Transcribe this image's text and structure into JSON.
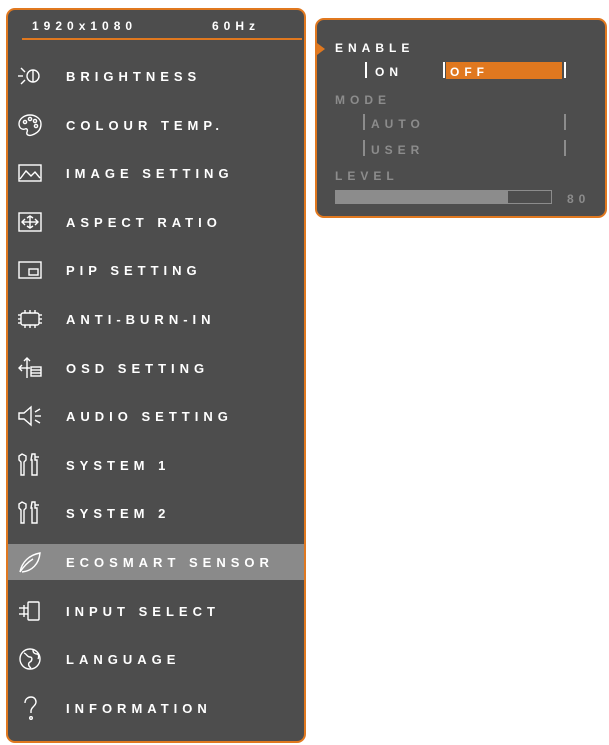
{
  "status_bar": {
    "resolution": "1920x1080",
    "refresh_rate": "60Hz"
  },
  "main_menu": {
    "selected_index": 10,
    "items": [
      {
        "label": "BRIGHTNESS",
        "icon": "brightness-icon"
      },
      {
        "label": "COLOUR TEMP.",
        "icon": "palette-icon"
      },
      {
        "label": "IMAGE SETTING",
        "icon": "image-icon"
      },
      {
        "label": "ASPECT RATIO",
        "icon": "aspect-ratio-icon"
      },
      {
        "label": "PIP SETTING",
        "icon": "pip-icon"
      },
      {
        "label": "ANTI-BURN-IN",
        "icon": "chip-icon"
      },
      {
        "label": "OSD SETTING",
        "icon": "osd-icon"
      },
      {
        "label": "AUDIO SETTING",
        "icon": "speaker-icon"
      },
      {
        "label": "SYSTEM 1",
        "icon": "tools-icon"
      },
      {
        "label": "SYSTEM 2",
        "icon": "tools-icon"
      },
      {
        "label": "ECOSMART SENSOR",
        "icon": "leaf-icon"
      },
      {
        "label": "INPUT SELECT",
        "icon": "plug-icon"
      },
      {
        "label": "LANGUAGE",
        "icon": "globe-icon"
      },
      {
        "label": "INFORMATION",
        "icon": "question-icon"
      }
    ]
  },
  "submenu": {
    "enable": {
      "label": "ENABLE",
      "options": [
        "ON",
        "OFF"
      ],
      "selected": "OFF"
    },
    "mode": {
      "label": "MODE",
      "options": [
        "AUTO",
        "USER"
      ]
    },
    "level": {
      "label": "LEVEL",
      "value": "80",
      "fraction": 0.8
    }
  },
  "colors": {
    "accent": "#e0781f",
    "panel": "#4d4d4d",
    "selected_row": "#8a8a8a",
    "disabled_text": "#8c8c8c"
  }
}
